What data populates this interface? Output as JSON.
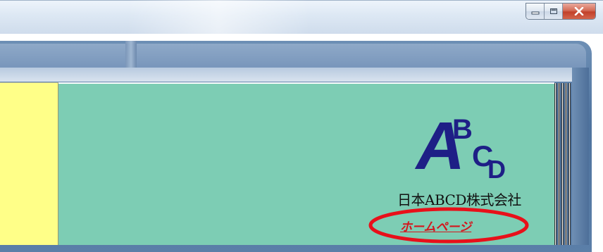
{
  "window": {
    "buttons": {
      "minimize_icon": "minimize-icon",
      "maximize_icon": "maximize-icon",
      "close_icon": "close-icon"
    }
  },
  "content": {
    "logo": {
      "a": "A",
      "b": "B",
      "c": "C",
      "d": "D"
    },
    "company_name": "日本ABCD株式会社",
    "homepage_link": "ホームページ",
    "annotation_color": "#e8101a"
  },
  "colors": {
    "left_panel": "#ffff88",
    "main_panel": "#7dcdb4",
    "logo": "#1e1f86",
    "link": "#d4161d"
  }
}
